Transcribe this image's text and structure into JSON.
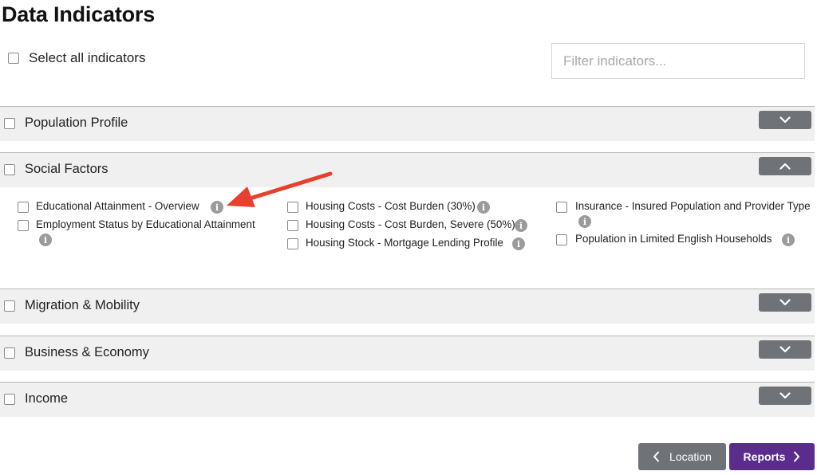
{
  "page": {
    "title": "Data Indicators"
  },
  "select_all": {
    "label": "Select all indicators"
  },
  "filter": {
    "placeholder": "Filter indicators..."
  },
  "sections": [
    {
      "label": "Population Profile",
      "expanded": false
    },
    {
      "label": "Social Factors",
      "expanded": true
    },
    {
      "label": "Migration & Mobility",
      "expanded": false
    },
    {
      "label": "Business & Economy",
      "expanded": false
    },
    {
      "label": "Income",
      "expanded": false
    }
  ],
  "social_factors": {
    "col1": [
      {
        "label": "Educational Attainment - Overview"
      },
      {
        "label": "Employment Status by Educational Attainment"
      }
    ],
    "col2": [
      {
        "label": "Housing Costs - Cost Burden (30%)"
      },
      {
        "label": "Housing Costs - Cost Burden, Severe (50%)"
      },
      {
        "label": "Housing Stock - Mortgage Lending Profile"
      }
    ],
    "col3": [
      {
        "label": "Insurance - Insured Population and Provider Type"
      },
      {
        "label": "Population in Limited English Households"
      }
    ]
  },
  "info_icon_glyph": "i",
  "nav": {
    "back_label": "Location",
    "next_label": "Reports"
  },
  "colors": {
    "accent": "#5a2c8c",
    "button_gray": "#6f7378",
    "section_bg": "#f0f0f0",
    "annotation_arrow": "#e8402e"
  }
}
